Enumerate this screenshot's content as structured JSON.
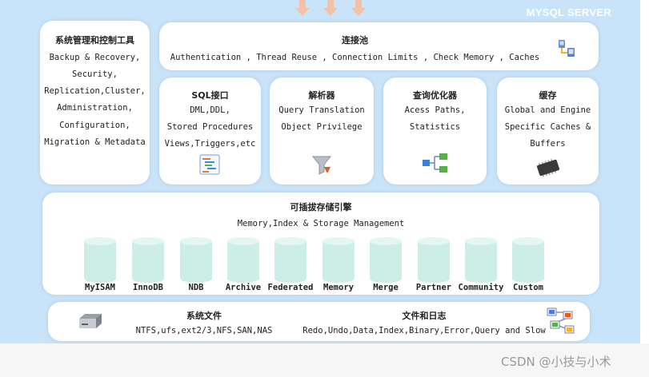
{
  "server_title": "MYSQL SERVER",
  "management": {
    "title": "系统管理和控制工具",
    "items": [
      "Backup & Recovery,",
      "Security,",
      "Replication,Cluster,",
      "Administration,",
      "Configuration,",
      "Migration & Metadata"
    ]
  },
  "connection_pool": {
    "title": "连接池",
    "items": "Authentication , Thread Reuse , Connection Limits , Check Memory , Caches"
  },
  "sql_interface": {
    "title": "SQL接口",
    "items": [
      "DML,DDL,",
      "Stored Procedures",
      "Views,Triggers,etc"
    ]
  },
  "parser": {
    "title": "解析器",
    "items": [
      "Query Translation",
      "Object Privilege"
    ]
  },
  "optimizer": {
    "title": "查询优化器",
    "items": [
      "Acess Paths,",
      "Statistics"
    ]
  },
  "cache": {
    "title": "缓存",
    "items": [
      "Global and Engine",
      "Specific Caches &",
      "Buffers"
    ]
  },
  "engines": {
    "title": "可插拔存储引擎",
    "subtitle": "Memory,Index & Storage Management",
    "list": [
      "MyISAM",
      "InnoDB",
      "NDB",
      "Archive",
      "Federated",
      "Memory",
      "Merge",
      "Partner",
      "Community",
      "Custom"
    ]
  },
  "files": {
    "fs_title": "系统文件",
    "fs_items": "NTFS,ufs,ext2/3,NFS,SAN,NAS",
    "log_title": "文件和日志",
    "log_items": "Redo,Undo,Data,Index,Binary,Error,Query and Slow"
  },
  "watermark": "CSDN @小技与小术",
  "colors": {
    "background": "#c9e3f8",
    "card": "#ffffff",
    "cylinder": "#cdeee6"
  },
  "icons": [
    "network-icon",
    "list-icon",
    "funnel-icon",
    "flow-icon",
    "chip-icon",
    "disk-icon",
    "files-icon"
  ]
}
